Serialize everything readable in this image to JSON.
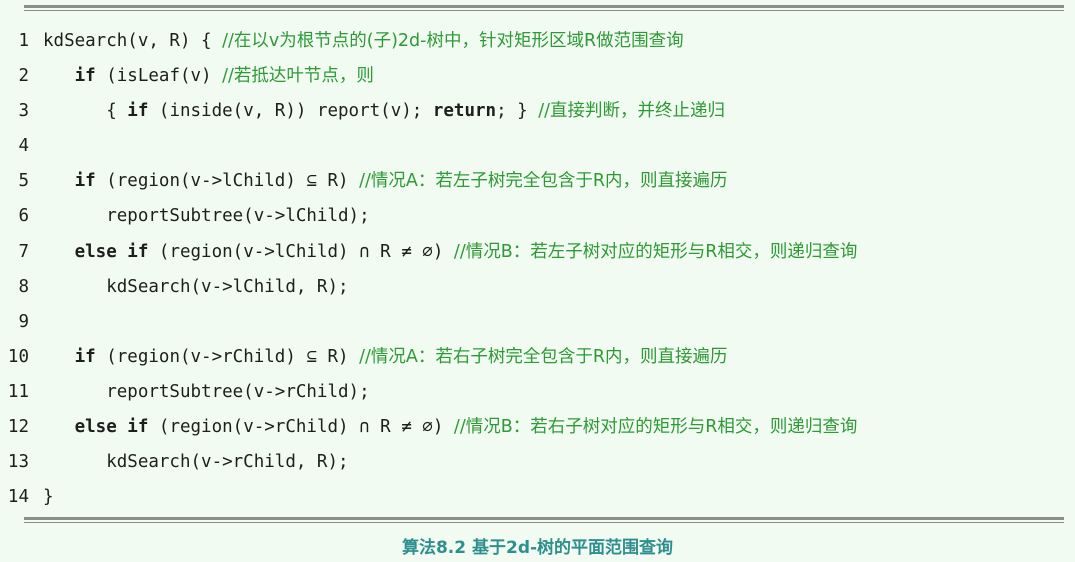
{
  "listing": {
    "lines": [
      {
        "num": "1",
        "segments": [
          {
            "t": "kdSearch(v, R) { ",
            "k": "c"
          },
          {
            "t": "//在以v为根节点的(子)2d-树中，针对矩形区域R做范围查询",
            "k": "cm"
          }
        ]
      },
      {
        "num": "2",
        "segments": [
          {
            "t": "   ",
            "k": "c"
          },
          {
            "t": "if",
            "k": "kw"
          },
          {
            "t": " (isLeaf(v) ",
            "k": "c"
          },
          {
            "t": "//若抵达叶节点，则",
            "k": "cm"
          }
        ]
      },
      {
        "num": "3",
        "segments": [
          {
            "t": "      { ",
            "k": "c"
          },
          {
            "t": "if",
            "k": "kw"
          },
          {
            "t": " (inside(v, R)) report(v); ",
            "k": "c"
          },
          {
            "t": "return",
            "k": "kw"
          },
          {
            "t": "; } ",
            "k": "c"
          },
          {
            "t": "//直接判断，并终止递归",
            "k": "cm"
          }
        ]
      },
      {
        "num": "4",
        "segments": []
      },
      {
        "num": "5",
        "segments": [
          {
            "t": "   ",
            "k": "c"
          },
          {
            "t": "if",
            "k": "kw"
          },
          {
            "t": " (region(v->lChild) ⊆ R) ",
            "k": "c"
          },
          {
            "t": "//情况A：若左子树完全包含于R内，则直接遍历",
            "k": "cm"
          }
        ]
      },
      {
        "num": "6",
        "segments": [
          {
            "t": "      reportSubtree(v->lChild);",
            "k": "c"
          }
        ]
      },
      {
        "num": "7",
        "segments": [
          {
            "t": "   ",
            "k": "c"
          },
          {
            "t": "else if",
            "k": "kw"
          },
          {
            "t": " (region(v->lChild) ∩ R ≠ ∅) ",
            "k": "c"
          },
          {
            "t": "//情况B：若左子树对应的矩形与R相交，则递归查询",
            "k": "cm"
          }
        ]
      },
      {
        "num": "8",
        "segments": [
          {
            "t": "      kdSearch(v->lChild, R);",
            "k": "c"
          }
        ]
      },
      {
        "num": "9",
        "segments": []
      },
      {
        "num": "10",
        "segments": [
          {
            "t": "   ",
            "k": "c"
          },
          {
            "t": "if",
            "k": "kw"
          },
          {
            "t": " (region(v->rChild) ⊆ R) ",
            "k": "c"
          },
          {
            "t": "//情况A：若右子树完全包含于R内，则直接遍历",
            "k": "cm"
          }
        ]
      },
      {
        "num": "11",
        "segments": [
          {
            "t": "      reportSubtree(v->rChild);",
            "k": "c"
          }
        ]
      },
      {
        "num": "12",
        "segments": [
          {
            "t": "   ",
            "k": "c"
          },
          {
            "t": "else if",
            "k": "kw"
          },
          {
            "t": " (region(v->rChild) ∩ R ≠ ∅) ",
            "k": "c"
          },
          {
            "t": "//情况B：若右子树对应的矩形与R相交，则递归查询",
            "k": "cm"
          }
        ]
      },
      {
        "num": "13",
        "segments": [
          {
            "t": "      kdSearch(v->rChild, R);",
            "k": "c"
          }
        ]
      },
      {
        "num": "14",
        "segments": [
          {
            "t": "}",
            "k": "c"
          }
        ]
      }
    ]
  },
  "caption": "算法8.2  基于2d-树的平面范围查询",
  "colors": {
    "background": "#f1fbf1",
    "comment": "#2e9a36",
    "caption": "#2f8f8f",
    "rule": "#8a8f8a"
  }
}
